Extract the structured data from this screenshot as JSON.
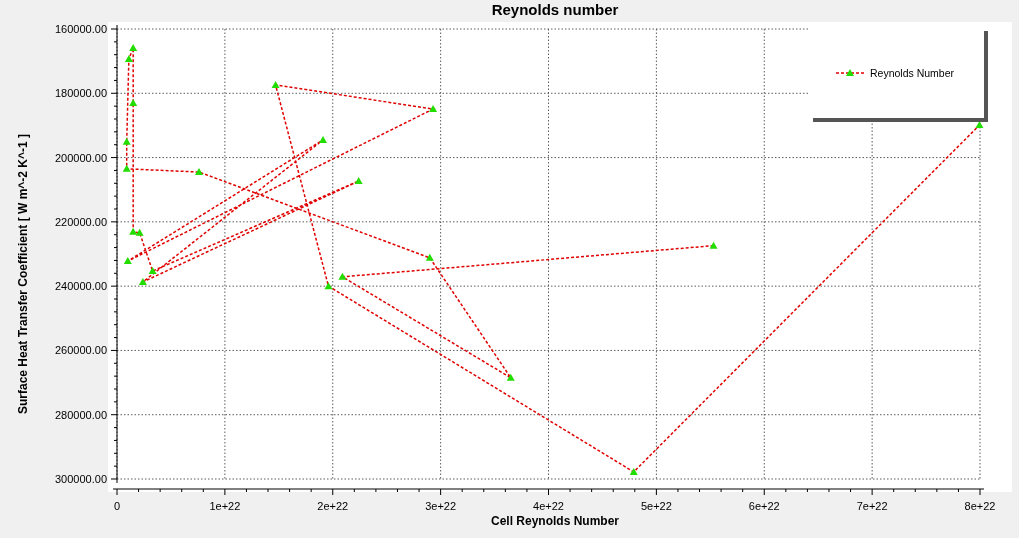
{
  "chart_data": {
    "type": "line",
    "title": "Reynolds number",
    "xlabel": "Cell Reynolds Number",
    "ylabel": "Surface Heat Transfer Coefficient [ W m^-2 K^-1 ]",
    "x": [
      5.53e+22,
      2.09e+22,
      3.65e+22,
      2.9e+22,
      7.6e+21,
      9e+20,
      9e+20,
      1.1e+21,
      1.5e+21,
      1.5e+21,
      1.5e+21,
      2.1e+21,
      3.3e+21,
      2.24e+22,
      2.4e+21,
      1.91e+22,
      1e+21,
      2.93e+22,
      1.47e+22,
      1.96e+22,
      4.79e+22,
      7.995e+22
    ],
    "grid": true,
    "series": [
      {
        "name": "Reynolds Number",
        "color": "#e00000",
        "line_style": "dashed",
        "marker": "triangle",
        "values": [
          227400,
          237100,
          268500,
          231200,
          204500,
          203500,
          195100,
          169300,
          165900,
          183000,
          223100,
          223400,
          235300,
          207300,
          238700,
          194500,
          232200,
          184900,
          177400,
          240000,
          297800,
          189900
        ]
      }
    ],
    "xlim": [
      0,
      8e+22
    ],
    "ylim": [
      300000,
      160000
    ],
    "xticks": [
      {
        "value": 0,
        "label": "0"
      },
      {
        "value": 1e+22,
        "label": "1e+22"
      },
      {
        "value": 2e+22,
        "label": "2e+22"
      },
      {
        "value": 3e+22,
        "label": "3e+22"
      },
      {
        "value": 4e+22,
        "label": "4e+22"
      },
      {
        "value": 5e+22,
        "label": "5e+22"
      },
      {
        "value": 6e+22,
        "label": "6e+22"
      },
      {
        "value": 7e+22,
        "label": "7e+22"
      },
      {
        "value": 8e+22,
        "label": "8e+22"
      }
    ],
    "yticks": [
      {
        "value": 160000,
        "label": "160000.00"
      },
      {
        "value": 180000,
        "label": "180000.00"
      },
      {
        "value": 200000,
        "label": "200000.00"
      },
      {
        "value": 220000,
        "label": "220000.00"
      },
      {
        "value": 240000,
        "label": "240000.00"
      },
      {
        "value": 260000,
        "label": "260000.00"
      },
      {
        "value": 280000,
        "label": "280000.00"
      },
      {
        "value": 300000,
        "label": "300000.00"
      }
    ]
  }
}
